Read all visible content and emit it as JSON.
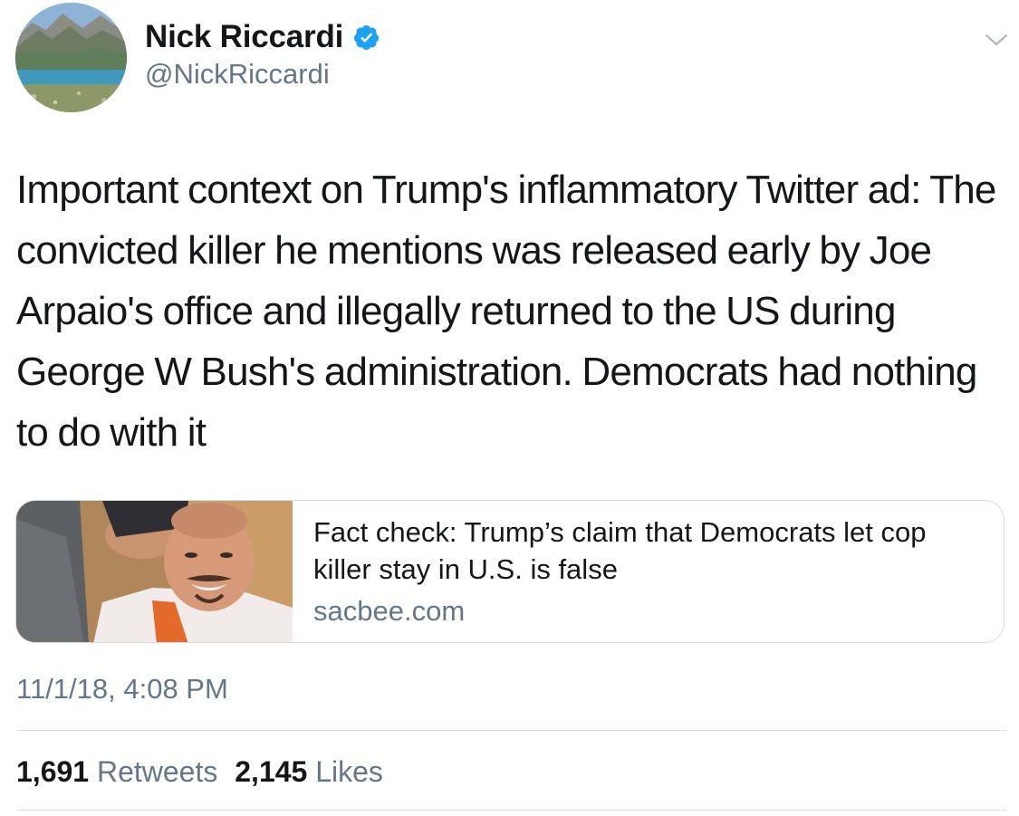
{
  "author": {
    "display_name": "Nick Riccardi",
    "handle": "@NickRiccardi",
    "verified": true,
    "avatar_icon": "landscape-avatar",
    "verified_color": "#1da1f2"
  },
  "menu_icon": "chevron-down-icon",
  "tweet": {
    "text": "Important context on Trump's inflammatory Twitter ad: The convicted killer he mentions was released early by Joe Arpaio's office and illegally returned to the US during George W Bush's administration. Democrats had nothing to do with it",
    "timestamp": "11/1/18, 4:08 PM"
  },
  "link_card": {
    "title": "Fact check: Trump’s claim that Democrats let cop killer stay in U.S. is false",
    "domain": "sacbee.com",
    "thumbnail_icon": "news-photo-thumbnail"
  },
  "stats": {
    "retweets_count": "1,691",
    "retweets_label": "Retweets",
    "likes_count": "2,145",
    "likes_label": "Likes"
  },
  "colors": {
    "text_primary": "#14171a",
    "text_secondary": "#657786",
    "border": "#d5dde3"
  }
}
